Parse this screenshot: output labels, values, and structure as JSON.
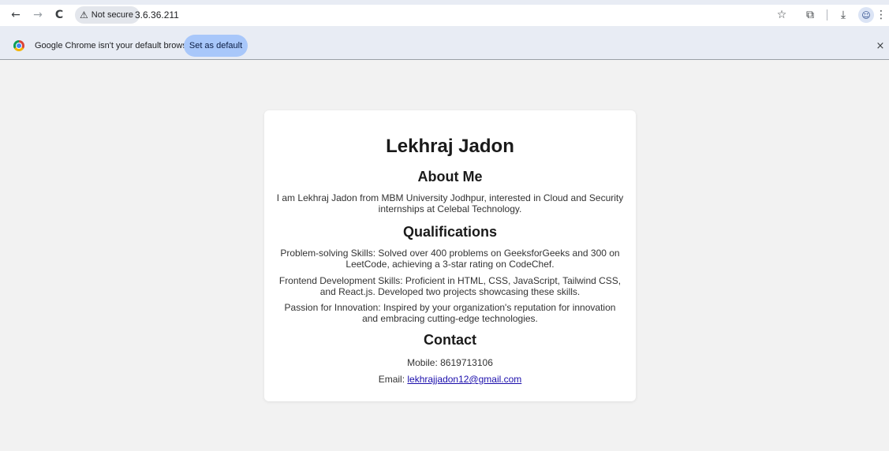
{
  "browser": {
    "back_icon": "←",
    "forward_icon": "→",
    "reload_icon": "C",
    "security_label": "Not secure",
    "url": "3.6.36.211",
    "star_icon": "☆",
    "extensions_icon": "⧉",
    "download_icon": "⤓",
    "menu_icon": "⋮"
  },
  "infobar": {
    "message": "Google Chrome isn't your default browser",
    "button_label": "Set as default",
    "close_icon": "×"
  },
  "page": {
    "name": "Lekhraj Jadon",
    "about_heading": "About Me",
    "about_text": "I am Lekhraj Jadon from MBM University Jodhpur, interested in Cloud and Security internships at Celebal Technology.",
    "qualifications_heading": "Qualifications",
    "qualifications": [
      "Problem-solving Skills: Solved over 400 problems on GeeksforGeeks and 300 on LeetCode, achieving a 3-star rating on CodeChef.",
      "Frontend Development Skills: Proficient in HTML, CSS, JavaScript, Tailwind CSS, and React.js. Developed two projects showcasing these skills.",
      "Passion for Innovation: Inspired by your organization's reputation for innovation and embracing cutting-edge technologies."
    ],
    "contact_heading": "Contact",
    "mobile_text": "Mobile: 8619713106",
    "email_label": "Email: ",
    "email": "lekhrajjadon12@gmail.com"
  }
}
